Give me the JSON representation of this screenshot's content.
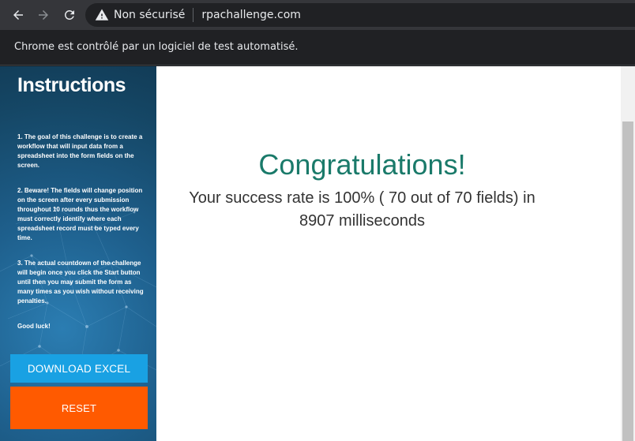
{
  "browser": {
    "security_label": "Non sécurisé",
    "url": "rpachallenge.com",
    "infobar_text": "Chrome est contrôlé par un logiciel de test automatisé."
  },
  "sidebar": {
    "title": "Instructions",
    "instructions": [
      "1. The goal of this challenge is to create a workflow that will input data from a spreadsheet into the form fields on the screen.",
      "2. Beware! The fields will change position on the screen after every submission throughout 10 rounds thus the workflow must correctly identify where each spreadsheet record must be typed every time.",
      "3. The actual countdown of the challenge will begin once you click the Start button until then you may submit the form as many times as you wish without receiving penalties.",
      "Good luck!"
    ],
    "download_label": "DOWNLOAD EXCEL",
    "reset_label": "RESET"
  },
  "main": {
    "heading": "Congratulations!",
    "message_line1": "Your success rate is 100% ( 70 out of 70 fields) in",
    "message_line2": "8907 milliseconds"
  },
  "colors": {
    "heading": "#1a7a6a",
    "download_button": "#19a1e3",
    "reset_button": "#ff5a00",
    "sidebar": "#1e5f8c"
  },
  "icons": [
    "back-arrow-icon",
    "forward-arrow-icon",
    "reload-icon",
    "warning-icon"
  ]
}
